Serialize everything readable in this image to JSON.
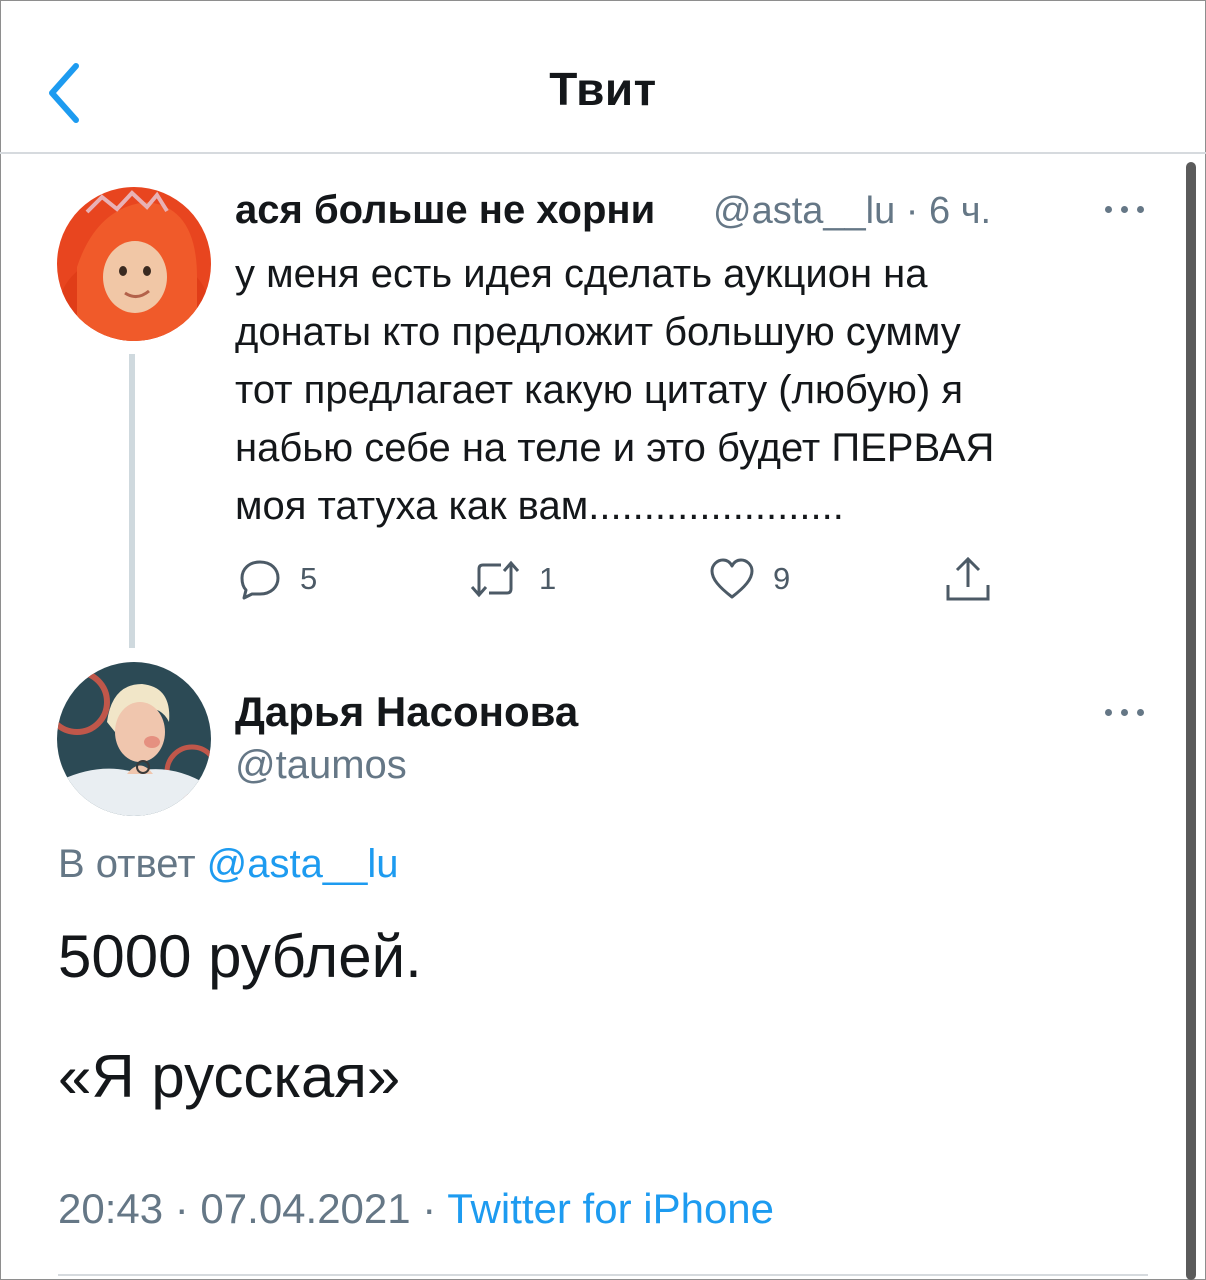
{
  "header": {
    "title": "Твит",
    "back_icon": "chevron-left-icon"
  },
  "colors": {
    "accent": "#1d9bf0",
    "muted": "#657786",
    "text": "#14171a"
  },
  "parent_tweet": {
    "author_name": "ася больше не хорни",
    "handle": "@asta__lu",
    "time": "6 ч.",
    "meta": "@asta__lu · 6 ч.",
    "text": "у меня есть идея сделать аукцион на\nдонаты кто предложит большую сумму\nтот предлагает какую цитату (любую) я\nнабью себе на теле и это будет ПЕРВАЯ\nмоя татуха как вам.......................",
    "replies": "5",
    "retweets": "1",
    "likes": "9"
  },
  "main_tweet": {
    "author_name": "Дарья Насонова",
    "handle": "@taumos",
    "reply_label": "В ответ",
    "reply_handle": "@asta__lu",
    "text_line_1": "5000 рублей.",
    "text_line_2": "«Я русская»",
    "timestamp": "20:43 · 07.04.2021 · ",
    "source": "Twitter for iPhone"
  }
}
